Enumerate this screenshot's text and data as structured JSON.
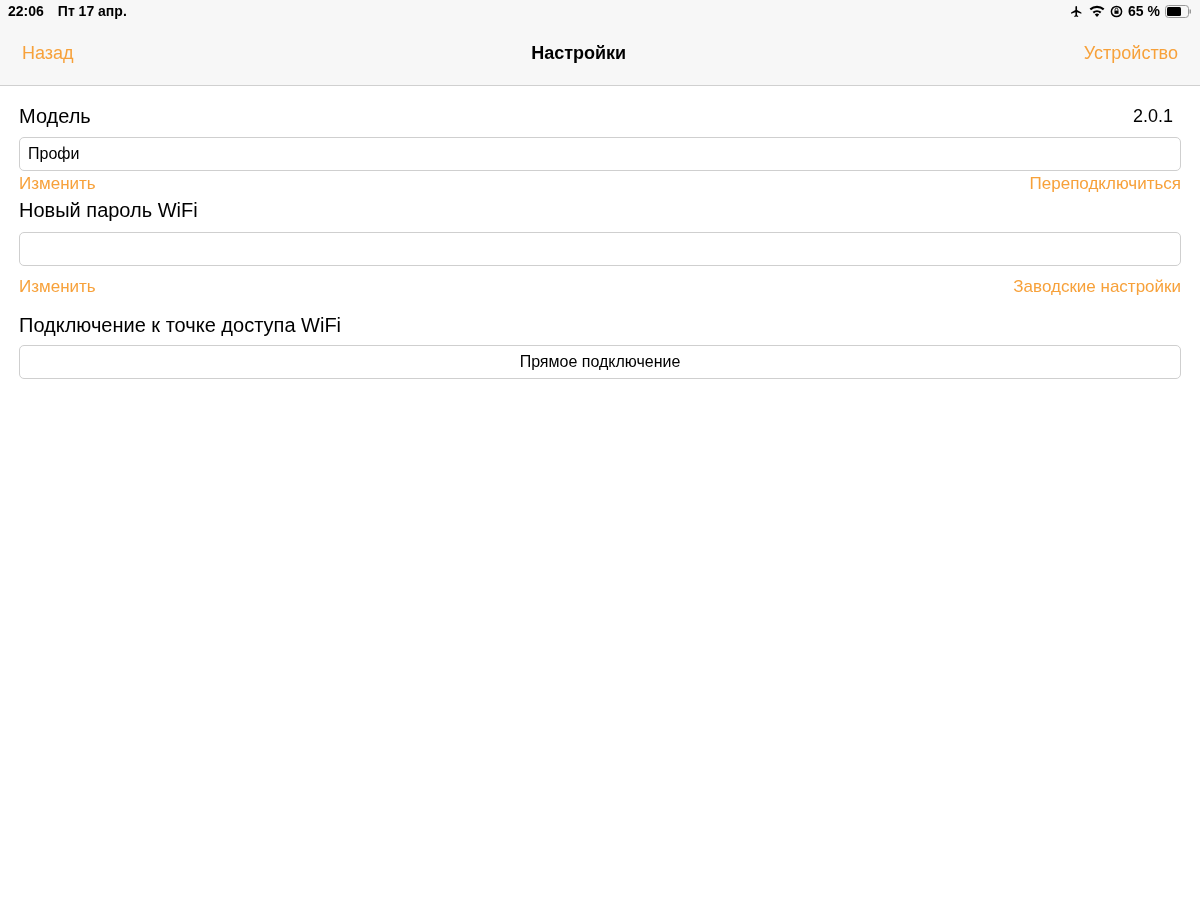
{
  "status_bar": {
    "time": "22:06",
    "date": "Пт 17 апр.",
    "battery": "65 %"
  },
  "nav": {
    "back": "Назад",
    "title": "Настройки",
    "right": "Устройство"
  },
  "model": {
    "label": "Модель",
    "version": "2.0.1",
    "value": "Профи",
    "links": [
      "Изменить",
      "Переподключиться"
    ]
  },
  "password": {
    "label": "Новый пароль WiFi",
    "links": [
      "Изменить",
      "Заводские настройки"
    ]
  },
  "access_point": {
    "label": "Подключение к точке доступа WiFi",
    "button": "Прямое подключение"
  }
}
